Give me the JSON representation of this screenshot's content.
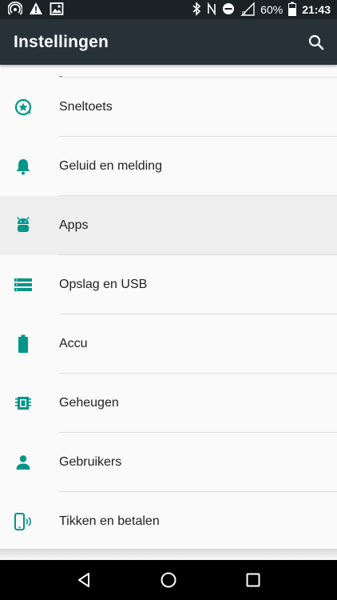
{
  "status_bar": {
    "time": "21:43",
    "battery_percent": "60%",
    "icons_left": [
      "hotspot-icon",
      "warning-icon",
      "gallery-icon"
    ],
    "icons_right": [
      "bluetooth-icon",
      "nfc-icon",
      "do-not-disturb-icon",
      "signal-icon",
      "battery-icon"
    ]
  },
  "toolbar": {
    "title": "Instellingen",
    "search_icon": "search-icon"
  },
  "accent_color": "#009688",
  "settings": [
    {
      "label": "Sneltoets",
      "icon": "star-bubble-icon",
      "selected": false
    },
    {
      "label": "Geluid en melding",
      "icon": "bell-icon",
      "selected": false
    },
    {
      "label": "Apps",
      "icon": "android-icon",
      "selected": true
    },
    {
      "label": "Opslag en USB",
      "icon": "storage-icon",
      "selected": false
    },
    {
      "label": "Accu",
      "icon": "battery-icon",
      "selected": false
    },
    {
      "label": "Geheugen",
      "icon": "memory-chip-icon",
      "selected": false
    },
    {
      "label": "Gebruikers",
      "icon": "person-icon",
      "selected": false
    },
    {
      "label": "Tikken en betalen",
      "icon": "tap-pay-icon",
      "selected": false
    }
  ],
  "nav_bar": {
    "buttons": [
      "back-icon",
      "home-icon",
      "recents-icon"
    ]
  }
}
